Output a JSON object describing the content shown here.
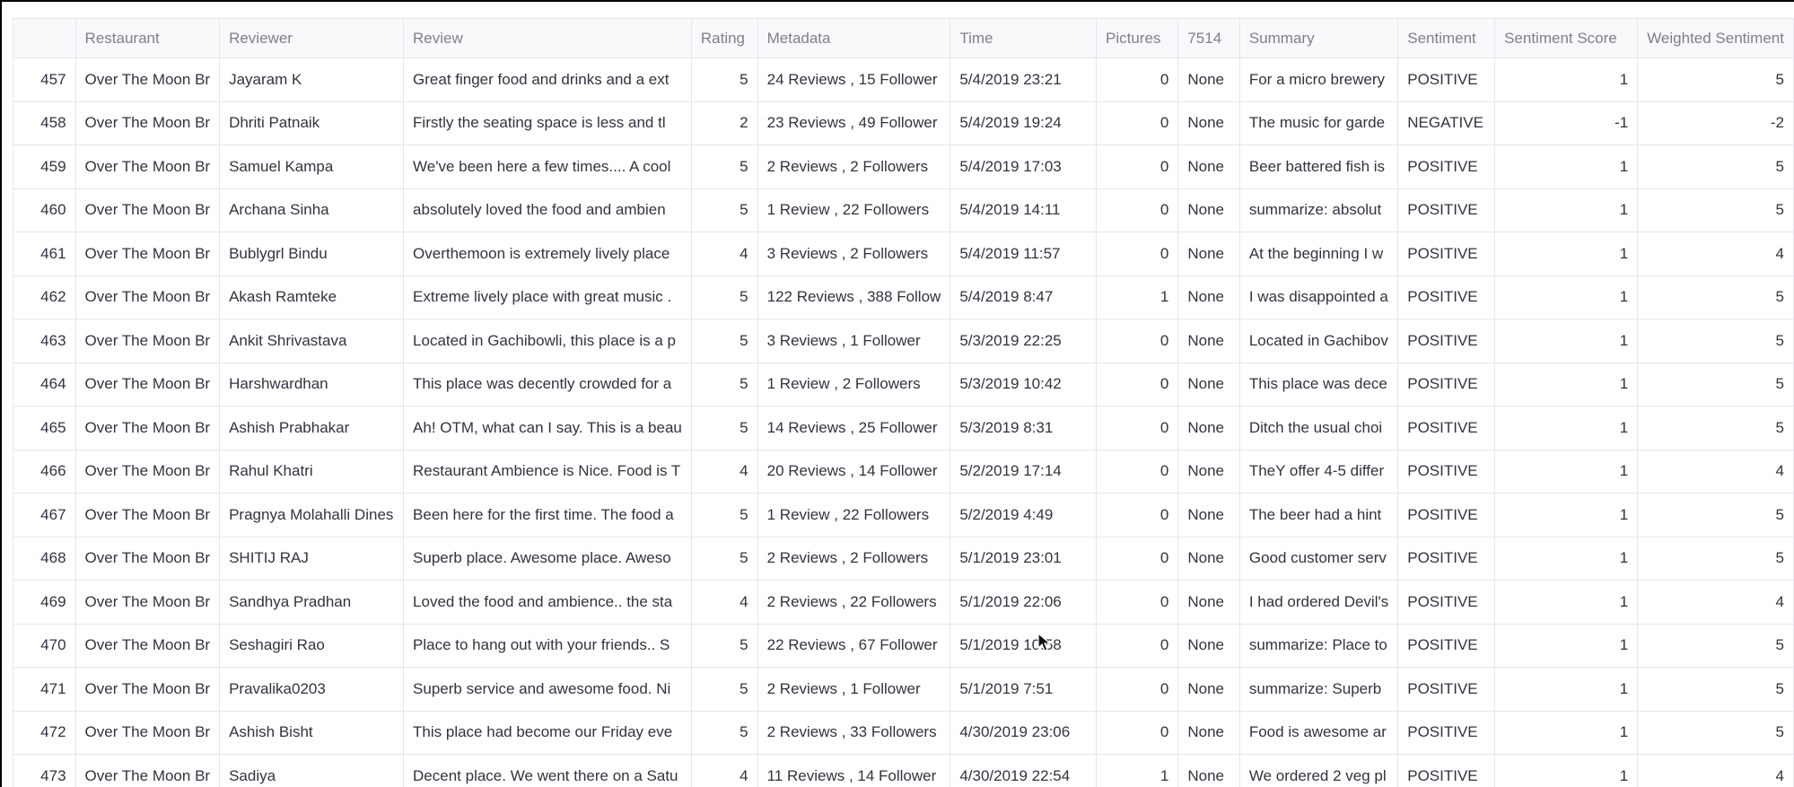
{
  "table": {
    "columns": [
      "",
      "Restaurant",
      "Reviewer",
      "Review",
      "Rating",
      "Metadata",
      "Time",
      "Pictures",
      "7514",
      "Summary",
      "Sentiment",
      "Sentiment Score",
      "Weighted Sentiment"
    ],
    "rows": [
      [
        "457",
        "Over The Moon Br",
        "Jayaram K",
        "Great finger food and drinks and a ext",
        "5",
        "24 Reviews , 15 Follower",
        "5/4/2019 23:21",
        "0",
        "None",
        "For a micro brewery",
        "POSITIVE",
        "1",
        "5"
      ],
      [
        "458",
        "Over The Moon Br",
        "Dhriti Patnaik",
        "Firstly the seating space is less and tl",
        "2",
        "23 Reviews , 49 Follower",
        "5/4/2019 19:24",
        "0",
        "None",
        "The music for garde",
        "NEGATIVE",
        "-1",
        "-2"
      ],
      [
        "459",
        "Over The Moon Br",
        "Samuel Kampa",
        "We've been here a few times.... A cool",
        "5",
        "2 Reviews , 2 Followers",
        "5/4/2019 17:03",
        "0",
        "None",
        "Beer battered fish is",
        "POSITIVE",
        "1",
        "5"
      ],
      [
        "460",
        "Over The Moon Br",
        "Archana Sinha",
        "absolutely loved the food and ambien",
        "5",
        "1 Review , 22 Followers",
        "5/4/2019 14:11",
        "0",
        "None",
        "summarize: absolut",
        "POSITIVE",
        "1",
        "5"
      ],
      [
        "461",
        "Over The Moon Br",
        "Bublygrl Bindu",
        "Overthemoon is extremely lively place",
        "4",
        "3 Reviews , 2 Followers",
        "5/4/2019 11:57",
        "0",
        "None",
        "At the beginning I w",
        "POSITIVE",
        "1",
        "4"
      ],
      [
        "462",
        "Over The Moon Br",
        "Akash Ramteke",
        "Extreme lively place with great music .",
        "5",
        "122 Reviews , 388 Follow",
        "5/4/2019 8:47",
        "1",
        "None",
        "I was disappointed a",
        "POSITIVE",
        "1",
        "5"
      ],
      [
        "463",
        "Over The Moon Br",
        "Ankit Shrivastava",
        "Located in Gachibowli, this place is a p",
        "5",
        "3 Reviews , 1 Follower",
        "5/3/2019 22:25",
        "0",
        "None",
        "Located in Gachibov",
        "POSITIVE",
        "1",
        "5"
      ],
      [
        "464",
        "Over The Moon Br",
        "Harshwardhan",
        "This place was decently crowded for a",
        "5",
        "1 Review , 2 Followers",
        "5/3/2019 10:42",
        "0",
        "None",
        "This place was dece",
        "POSITIVE",
        "1",
        "5"
      ],
      [
        "465",
        "Over The Moon Br",
        "Ashish Prabhakar",
        "Ah! OTM, what can I say. This is a beau",
        "5",
        "14 Reviews , 25 Follower",
        "5/3/2019 8:31",
        "0",
        "None",
        "Ditch the usual choi",
        "POSITIVE",
        "1",
        "5"
      ],
      [
        "466",
        "Over The Moon Br",
        "Rahul Khatri",
        "Restaurant Ambience is Nice. Food is T",
        "4",
        "20 Reviews , 14 Follower",
        "5/2/2019 17:14",
        "0",
        "None",
        "TheY offer 4-5 differ",
        "POSITIVE",
        "1",
        "4"
      ],
      [
        "467",
        "Over The Moon Br",
        "Pragnya Molahalli Dines",
        "Been here for the first time. The food a",
        "5",
        "1 Review , 22 Followers",
        "5/2/2019 4:49",
        "0",
        "None",
        "The beer had a hint",
        "POSITIVE",
        "1",
        "5"
      ],
      [
        "468",
        "Over The Moon Br",
        "SHITIJ RAJ",
        "Superb place. Awesome place. Aweso",
        "5",
        "2 Reviews , 2 Followers",
        "5/1/2019 23:01",
        "0",
        "None",
        "Good customer serv",
        "POSITIVE",
        "1",
        "5"
      ],
      [
        "469",
        "Over The Moon Br",
        "Sandhya Pradhan",
        "Loved the food and ambience.. the sta",
        "4",
        "2 Reviews , 22 Followers",
        "5/1/2019 22:06",
        "0",
        "None",
        "I had ordered Devil's",
        "POSITIVE",
        "1",
        "4"
      ],
      [
        "470",
        "Over The Moon Br",
        "Seshagiri Rao",
        "Place to hang out with your friends.. S",
        "5",
        "22 Reviews , 67 Follower",
        "5/1/2019 10:58",
        "0",
        "None",
        "summarize: Place to",
        "POSITIVE",
        "1",
        "5"
      ],
      [
        "471",
        "Over The Moon Br",
        "Pravalika0203",
        "Superb service and awesome food. Ni",
        "5",
        "2 Reviews , 1 Follower",
        "5/1/2019 7:51",
        "0",
        "None",
        "summarize: Superb",
        "POSITIVE",
        "1",
        "5"
      ],
      [
        "472",
        "Over The Moon Br",
        "Ashish Bisht",
        "This place had become our Friday eve",
        "5",
        "2 Reviews , 33 Followers",
        "4/30/2019 23:06",
        "0",
        "None",
        "Food is awesome ar",
        "POSITIVE",
        "1",
        "5"
      ],
      [
        "473",
        "Over The Moon Br",
        "Sadiya",
        "Decent place. We went there on a Satu",
        "4",
        "11 Reviews , 14 Follower",
        "4/30/2019 22:54",
        "1",
        "None",
        "We ordered 2 veg pl",
        "POSITIVE",
        "1",
        "4"
      ]
    ]
  },
  "colors": {
    "header_text": "#7e8089",
    "cell_text": "#31333f",
    "index_text": "#8a8c94",
    "none_text": "#b7b9be",
    "grid_line": "#e4e6ea"
  },
  "icons": {
    "pointer": "mouse-pointer-icon"
  }
}
